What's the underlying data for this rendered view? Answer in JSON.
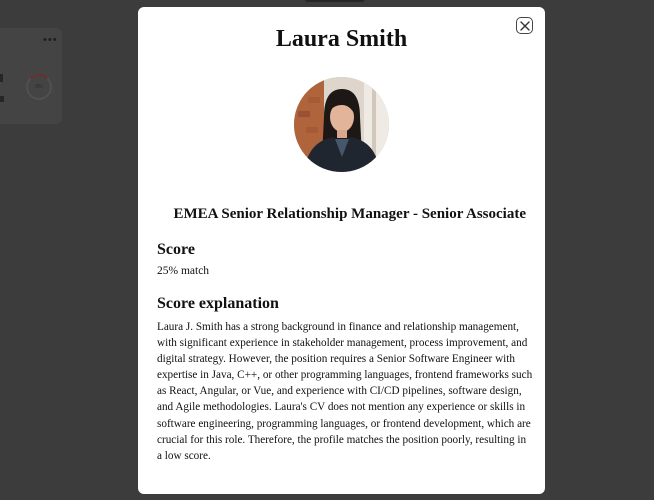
{
  "background": {
    "menu_dots": "•••",
    "score_ring_label": "0%"
  },
  "modal": {
    "name": "Laura Smith",
    "close_icon": "close-x-icon",
    "avatar_alt": "Laura Smith",
    "position": "EMEA Senior Relationship Manager - Senior Associate",
    "score_heading": "Score",
    "score_value": "25% match",
    "explanation_heading": "Score explanation",
    "explanation_text": "Laura J. Smith has a strong background in finance and relationship management, with significant experience in stakeholder management, process improvement, and digital strategy. However, the position requires a Senior Software Engineer with expertise in Java, C++, or other programming languages, frontend frameworks such as React, Angular, or Vue, and experience with CI/CD pipelines, software design, and Agile methodologies. Laura's CV does not mention any experience or skills in software engineering, programming languages, or frontend development, which are crucial for this role. Therefore, the profile matches the position poorly, resulting in a low score."
  },
  "colors": {
    "overlay": "#3c3c3c",
    "modal_bg": "#ffffff",
    "text": "#111111"
  }
}
